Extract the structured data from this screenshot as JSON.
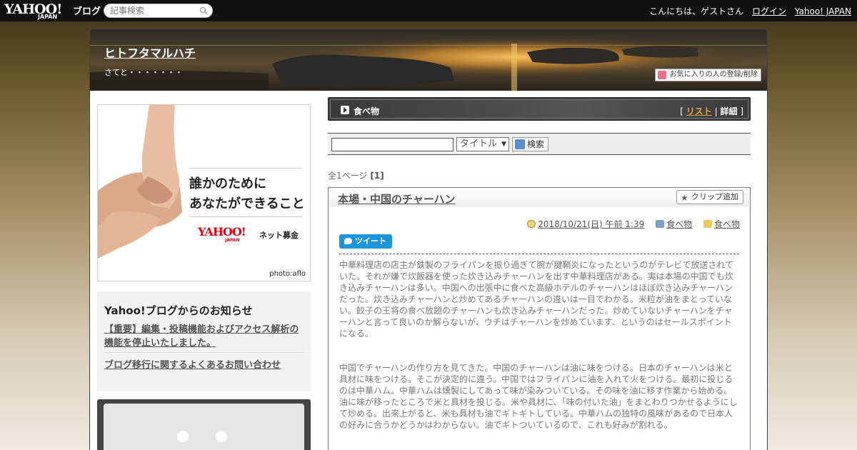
{
  "topbar": {
    "logo_text": "YAHOO!",
    "logo_japan": "JAPAN",
    "logo_blog": "ブログ",
    "search_placeholder": "記事検索",
    "greeting": "こんにちは、ゲストさん",
    "login": "ログイン",
    "yahoo_japan": "Yahoo! JAPAN"
  },
  "blog": {
    "title": "ヒトフタマルハチ",
    "subtitle": "さてと・・・・・・・",
    "fav_button": "お気に入りの人の登録/削除"
  },
  "ad": {
    "line1": "誰かのために",
    "line2": "あなたができること",
    "brand": "YAHOO!",
    "brand_japan": "JAPAN",
    "service": "ネット募金",
    "credit": "photo:aflo"
  },
  "notice": {
    "title": "Yahoo!ブログからのお知らせ",
    "link1": "【重要】編集・投稿機能およびアクセス解析の機能を停止いたしました。",
    "link2": "ブログ移行に関するよくあるお問い合わせ"
  },
  "category": {
    "title": "食べ物",
    "bracket_open": "[",
    "list": "リスト",
    "sep": "|",
    "detail": "詳細",
    "bracket_close": "]"
  },
  "search": {
    "select_value": "タイトル",
    "button": "検索"
  },
  "pager": {
    "label": "全1ページ",
    "current": "[1]"
  },
  "article": {
    "title": "本場・中国のチャーハン",
    "clip_button": "クリップ追加",
    "datetime": "2018/10/21(日) 午前 1:39",
    "category1": "食べ物",
    "category2": "食べ物",
    "tweet": "ツイート",
    "para1": "中華料理店の店主が鉄製のフライパンを振り過ぎて腕が腱鞘炎になったというのがテレビで放送されていた。それが嫌で炊飯器を使った炊き込みチャーハンを出す中華料理店がある。実は本場の中国でも炊き込みチャーハンは多い。中国への出張中に食べた高級ホテルのチャーハンはほぼ炊き込みチャーハンだった。炊き込みチャーハンと炒めてあるチャーハンの違いは一目でわかる。米粒が油をまとっていない。餃子の王将の食べ放題のチャーハンも炊き込みチャーハンだった。炒めていないチャーハンをチャーハンと言って良いのか解らないが、ウチはチャーハンを炒めています、というのはセールスポイントになる。",
    "para2": "中国でチャーハンの作り方を見てきた。中国のチャーハンは油に味をつける。日本のチャーハンは米と具材に味をつける。そこが決定的に違う。中国ではフライパンに油を入れて火をつける。最初に投じるのは中華ハム。中華ハムは燻製にしてあって味が染みついている。その味を油に移す作業から始める。油に味が移ったところで米と具材を投じる。米や具材に、「味の付いた油」をまとわりつかせるようにして炒める。出来上がると、米も具材も油でギトギトしている。中華ハムの独特の風味があるので日本人の好みに合うかどうかはわからない。油でギトついているので、これも好みが割れる。"
  }
}
